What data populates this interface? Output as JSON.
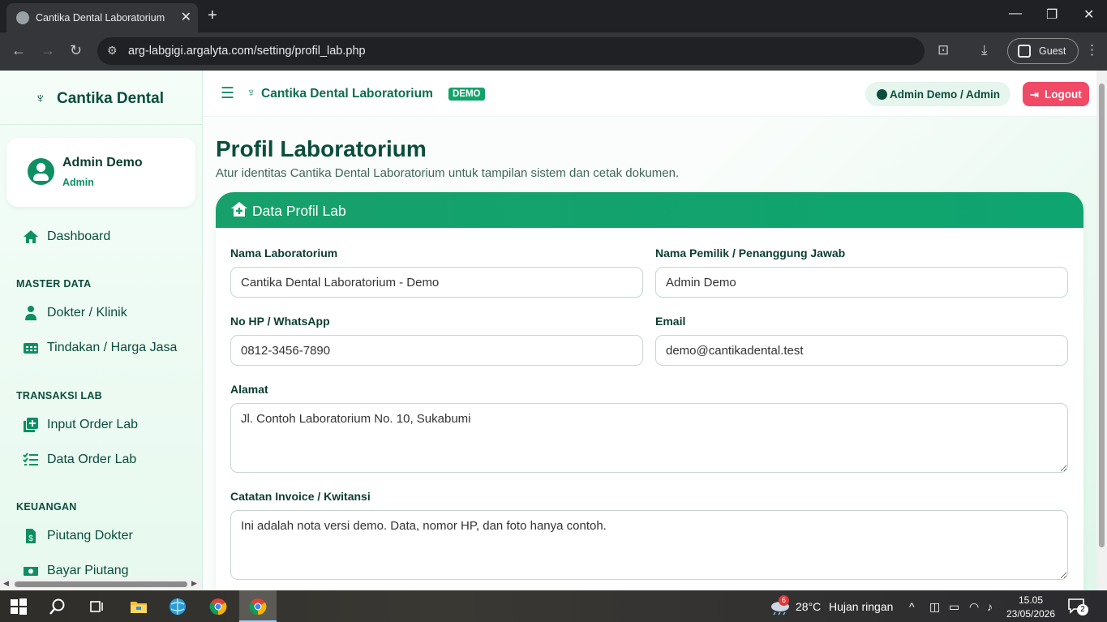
{
  "browser": {
    "tab_title": "Cantika Dental Laboratorium",
    "url": "arg-labgigi.argalyta.com/setting/profil_lab.php",
    "profile_label": "Guest"
  },
  "sidebar": {
    "brand": "Cantika Dental",
    "user_name": "Admin Demo",
    "user_role": "Admin",
    "dashboard": "Dashboard",
    "sections": {
      "master": "MASTER DATA",
      "transaksi": "TRANSAKSI LAB",
      "keuangan": "KEUANGAN"
    },
    "items": {
      "dokter": "Dokter / Klinik",
      "tindakan": "Tindakan / Harga Jasa",
      "input_order": "Input Order Lab",
      "data_order": "Data Order Lab",
      "piutang": "Piutang Dokter",
      "bayar": "Bayar Piutang"
    }
  },
  "topbar": {
    "app_title": "Cantika Dental Laboratorium",
    "badge": "DEMO",
    "user": "Admin Demo / Admin",
    "logout": "Logout"
  },
  "main": {
    "title": "Profil Laboratorium",
    "subtitle": "Atur identitas Cantika Dental Laboratorium untuk tampilan sistem dan cetak dokumen.",
    "card_title": "Data Profil Lab",
    "fields": {
      "nama_label": "Nama Laboratorium",
      "nama_value": "Cantika Dental Laboratorium - Demo",
      "pemilik_label": "Nama Pemilik / Penanggung Jawab",
      "pemilik_value": "Admin Demo",
      "hp_label": "No HP / WhatsApp",
      "hp_value": "0812-3456-7890",
      "email_label": "Email",
      "email_value": "demo@cantikadental.test",
      "alamat_label": "Alamat",
      "alamat_value": "Jl. Contoh Laboratorium No. 10, Sukabumi",
      "catatan_label": "Catatan Invoice / Kwitansi",
      "catatan_value": "Ini adalah nota versi demo. Data, nomor HP, dan foto hanya contoh."
    }
  },
  "taskbar": {
    "weather_temp": "28°C",
    "weather_text": "Hujan ringan",
    "weather_badge": "6",
    "time": "15.05",
    "date": "23/05/2026",
    "notif_count": "2"
  },
  "colors": {
    "primary": "#0e8f63",
    "dark_green": "#0b4d3b",
    "logout": "#f04a66"
  }
}
